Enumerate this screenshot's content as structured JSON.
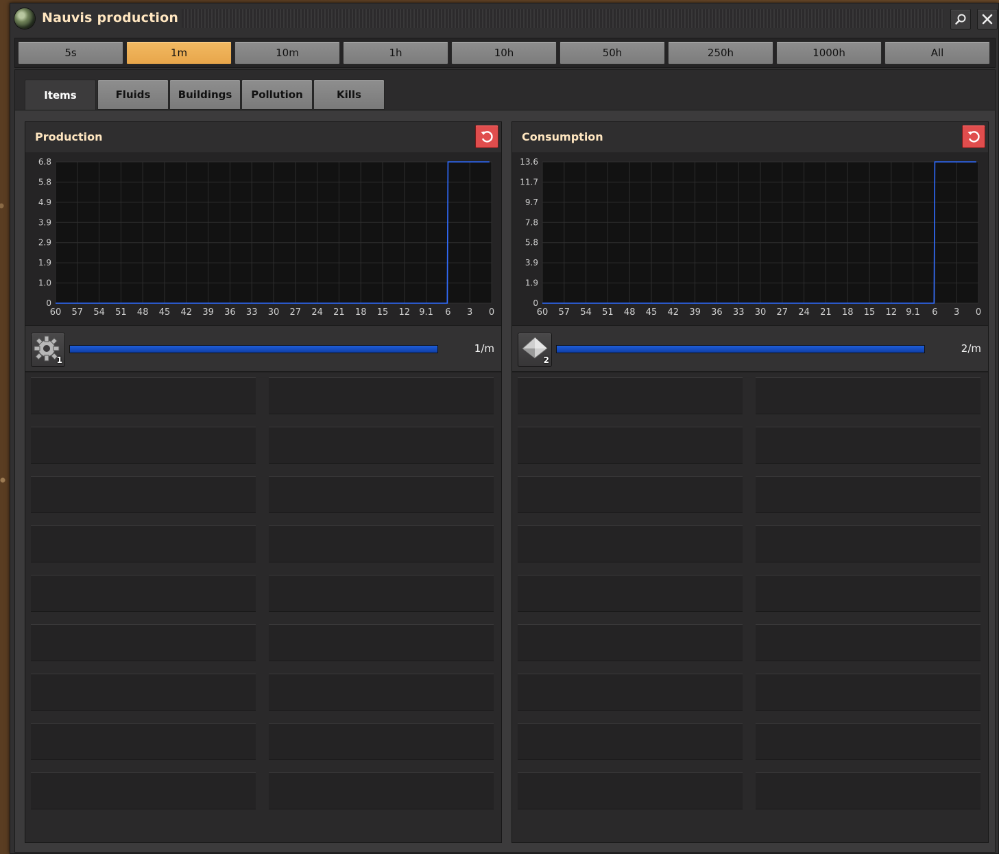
{
  "window": {
    "title": "Nauvis production",
    "search_icon": "search-icon",
    "close_icon": "close-icon"
  },
  "time_ranges": {
    "buttons": [
      "5s",
      "1m",
      "10m",
      "1h",
      "10h",
      "50h",
      "250h",
      "1000h",
      "All"
    ],
    "selected": "1m"
  },
  "tabs": {
    "items": [
      "Items",
      "Fluids",
      "Buildings",
      "Pollution",
      "Kills"
    ],
    "selected": "Items"
  },
  "production": {
    "title": "Production",
    "item_icon": "iron-gear-wheel-icon",
    "item_count": "1",
    "rate": "1/m",
    "bar_fill": 1.0
  },
  "consumption": {
    "title": "Consumption",
    "item_icon": "iron-plate-icon",
    "item_count": "2",
    "rate": "2/m",
    "bar_fill": 1.0
  },
  "colors": {
    "accent": "#e8a64a",
    "line": "#2f6bff",
    "reset": "#e04d4d"
  },
  "chart_data": [
    {
      "type": "line",
      "title": "Production",
      "x_ticks": [
        "60",
        "57",
        "54",
        "51",
        "48",
        "45",
        "42",
        "39",
        "36",
        "33",
        "30",
        "27",
        "24",
        "21",
        "18",
        "15",
        "12",
        "9.1",
        "6",
        "3",
        "0"
      ],
      "y_ticks": [
        "0",
        "1.0",
        "1.9",
        "2.9",
        "3.9",
        "4.9",
        "5.8",
        "6.8"
      ],
      "ylim": [
        0,
        6.8
      ],
      "xlim": [
        60,
        0
      ],
      "series": [
        {
          "x": [
            60,
            6.1,
            6.0,
            0.3
          ],
          "y": [
            0,
            0,
            6.8,
            6.8
          ]
        }
      ],
      "grid": true
    },
    {
      "type": "line",
      "title": "Consumption",
      "x_ticks": [
        "60",
        "57",
        "54",
        "51",
        "48",
        "45",
        "42",
        "39",
        "36",
        "33",
        "30",
        "27",
        "24",
        "21",
        "18",
        "15",
        "12",
        "9.1",
        "6",
        "3",
        "0"
      ],
      "y_ticks": [
        "0",
        "1.9",
        "3.9",
        "5.8",
        "7.8",
        "9.7",
        "11.7",
        "13.6"
      ],
      "ylim": [
        0,
        13.6
      ],
      "xlim": [
        60,
        0
      ],
      "series": [
        {
          "x": [
            60,
            6.1,
            6.0,
            0.3
          ],
          "y": [
            0,
            0,
            13.6,
            13.6
          ]
        }
      ],
      "grid": true
    }
  ]
}
